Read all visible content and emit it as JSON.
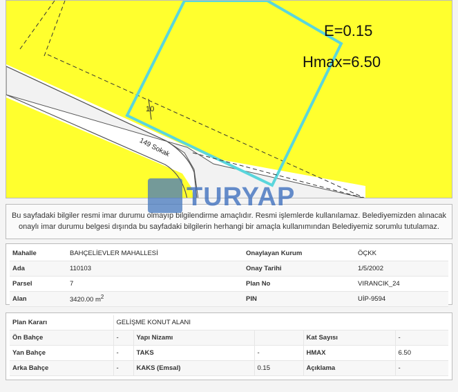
{
  "map": {
    "f_label": "E=0.15",
    "h_label": "Hmax=6.50",
    "street_label": "149 Sokak",
    "dimension_label": "10",
    "fill_color": "#ffff2e",
    "parcel_outline_color": "#5ad6dc",
    "watermark": "TURYAP"
  },
  "disclaimer": {
    "line1": "Bu sayfadaki bilgiler resmi imar durumu olmayıp bilgilendirme amaçlıdır. Resmi işlemlerde kullanılamaz. Belediyemizden alınacak",
    "line2": "onaylı imar durumu belgesi dışında bu sayfadaki bilgilerin herhangi bir amaçla kullanımından Belediyemiz sorumlu tutulamaz."
  },
  "parcel_info": {
    "mahalle_label": "Mahalle",
    "mahalle_value": "BAHÇELİEVLER MAHALLESİ",
    "kurum_label": "Onaylayan Kurum",
    "kurum_value": "ÖÇKK",
    "ada_label": "Ada",
    "ada_value": "110103",
    "onay_label": "Onay Tarihi",
    "onay_value": "1/5/2002",
    "parsel_label": "Parsel",
    "parsel_value": "7",
    "planno_label": "Plan No",
    "planno_value": "VIRANCIK_24",
    "alan_label": "Alan",
    "alan_value": "3420.00 m",
    "alan_unit_sup": "2",
    "pin_label": "PIN",
    "pin_value": "UİP-9594"
  },
  "plan_info": {
    "plan_karari_label": "Plan Kararı",
    "plan_karari_value": "GELİŞME KONUT ALANI",
    "on_bahce_label": "Ön Bahçe",
    "on_bahce_value": "-",
    "yapi_nizami_label": "Yapı Nizamı",
    "yapi_nizami_value": "",
    "kat_sayisi_label": "Kat Sayısı",
    "kat_sayisi_value": "-",
    "yan_bahce_label": "Yan Bahçe",
    "yan_bahce_value": "-",
    "taks_label": "TAKS",
    "taks_value": "-",
    "hmax_label": "HMAX",
    "hmax_value": "6.50",
    "arka_bahce_label": "Arka Bahçe",
    "arka_bahce_value": "-",
    "kaks_label": "KAKS (Emsal)",
    "kaks_value": "0.15",
    "aciklama_label": "Açıklama",
    "aciklama_value": "-"
  }
}
